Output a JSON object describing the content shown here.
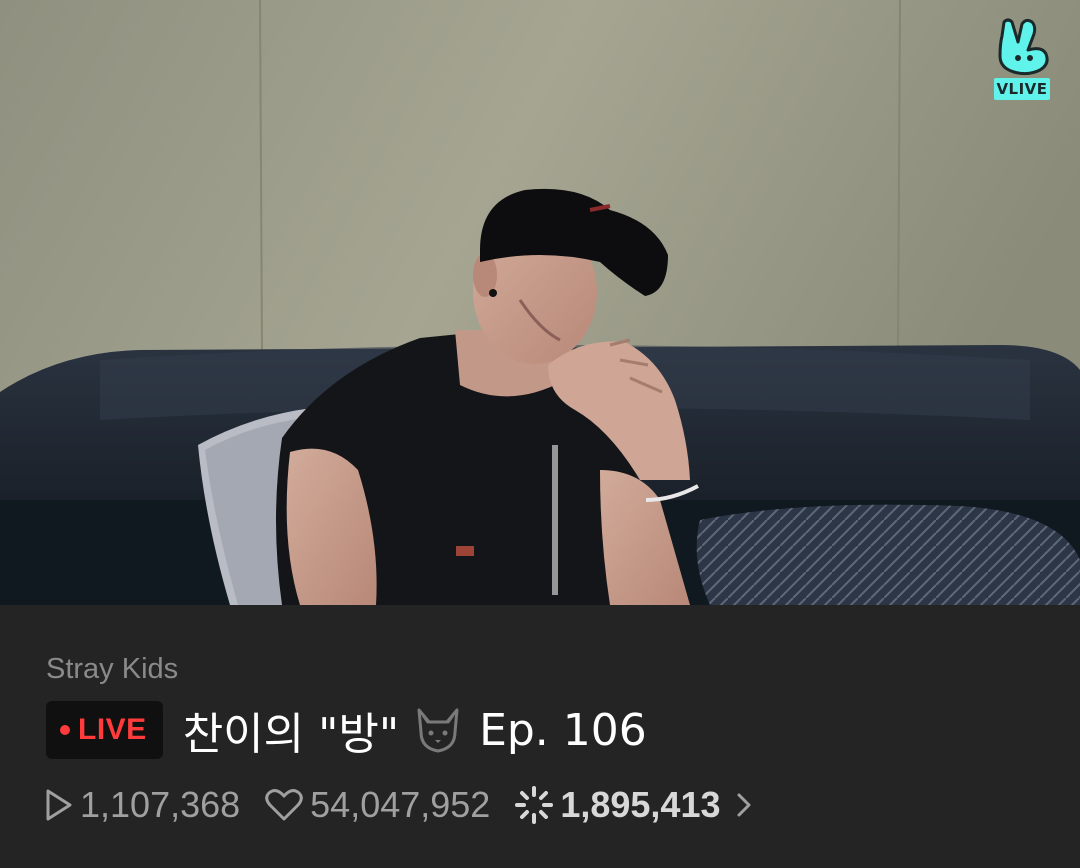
{
  "player": {
    "brand_label": "VLIVE",
    "brand_color": "#5ff3ec",
    "scene": "live-stream-video-frame"
  },
  "stream": {
    "channel": "Stray Kids",
    "live_label": "LIVE",
    "live_color": "#ff3b3b",
    "title_before": "찬이의 \"방\"",
    "title_icon": "wolf-emoji-icon",
    "title_after": "Ep. 106",
    "stats": {
      "plays": "1,107,368",
      "hearts": "54,047,952",
      "chemi": "1,895,413"
    }
  }
}
